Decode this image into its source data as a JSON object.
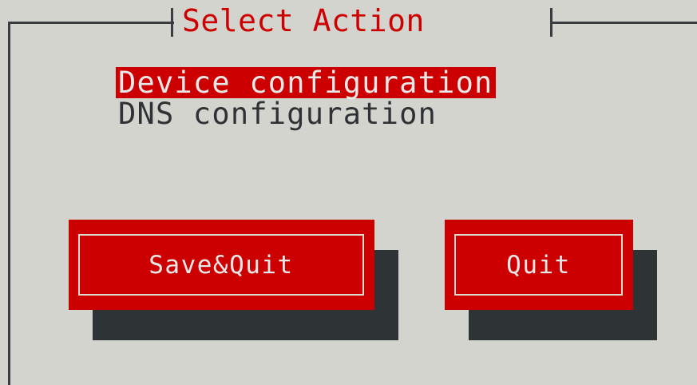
{
  "dialog": {
    "title": "Select Action"
  },
  "menu": {
    "items": [
      {
        "label": "Device configuration",
        "selected": true
      },
      {
        "label": "DNS configuration",
        "selected": false
      }
    ]
  },
  "buttons": {
    "save_quit": "Save&Quit",
    "quit": "Quit"
  },
  "colors": {
    "background": "#d4d4cf",
    "accent": "#cc0000",
    "shadow": "#2e3336",
    "text": "#2e3234"
  }
}
